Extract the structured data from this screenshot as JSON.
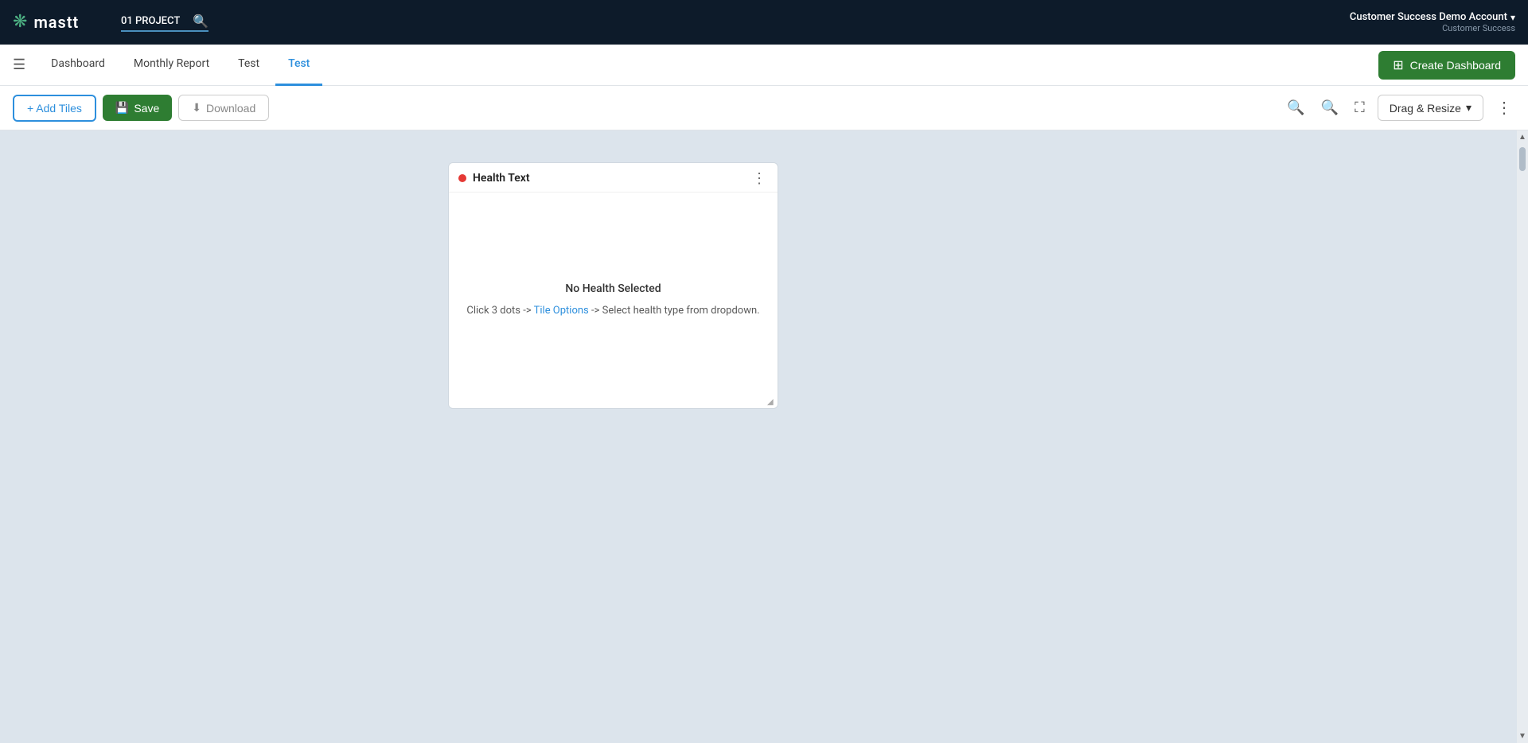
{
  "topNav": {
    "logoText": "mastt",
    "projectName": "01 PROJECT",
    "accountName": "Customer Success Demo Account",
    "accountSub": "Customer Success"
  },
  "tabBar": {
    "tabs": [
      {
        "id": "dashboard",
        "label": "Dashboard",
        "active": false
      },
      {
        "id": "monthly-report",
        "label": "Monthly Report",
        "active": false
      },
      {
        "id": "test1",
        "label": "Test",
        "active": false
      },
      {
        "id": "test2",
        "label": "Test",
        "active": true
      }
    ],
    "createDashboardLabel": "Create Dashboard"
  },
  "toolbar": {
    "addTilesLabel": "+ Add Tiles",
    "saveLabel": "Save",
    "downloadLabel": "Download",
    "dragResizeLabel": "Drag & Resize"
  },
  "tile": {
    "statusColor": "#e53935",
    "title": "Health Text",
    "emptyTitle": "No Health Selected",
    "instruction": "Click 3 dots -> Tile Options -> Select health type from dropdown.",
    "instructionLinkText": "Tile Options"
  }
}
